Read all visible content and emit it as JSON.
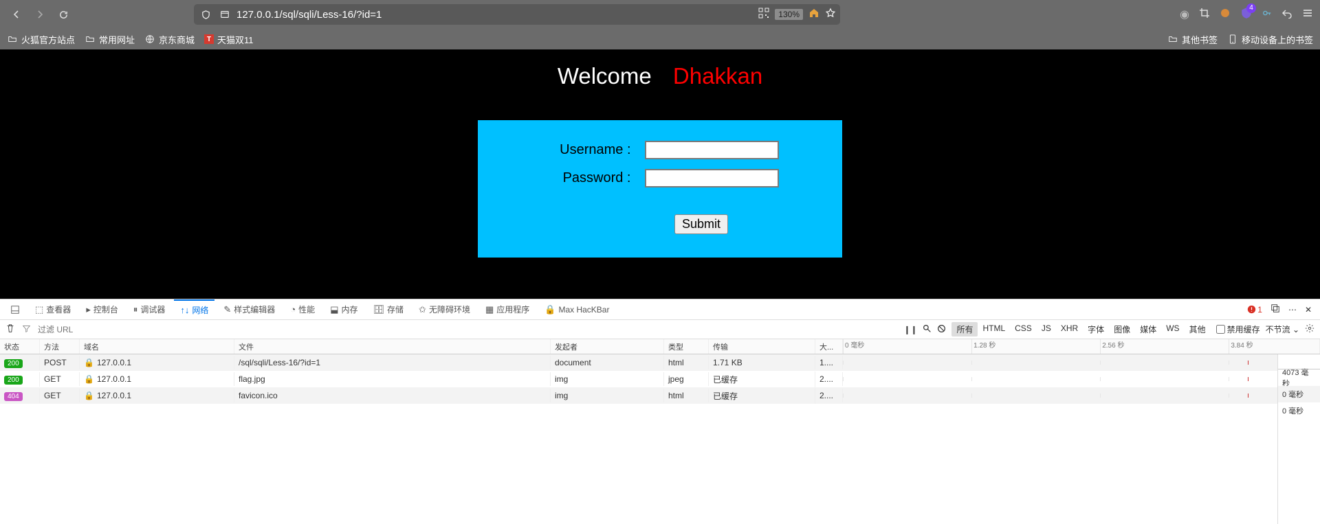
{
  "browser": {
    "url": "127.0.0.1/sql/sqli/Less-16/?id=1",
    "zoom": "130%",
    "extBadge": "4",
    "bookmarks": {
      "b1": "火狐官方站点",
      "b2": "常用网址",
      "b3": "京东商城",
      "b4": "天猫双11",
      "r1": "其他书签",
      "r2": "移动设备上的书签"
    }
  },
  "page": {
    "welcome1": "Welcome",
    "welcome2": "Dhakkan",
    "usernameLabel": "Username :",
    "passwordLabel": "Password :",
    "submit": "Submit"
  },
  "devtools": {
    "tabs": {
      "inspector": "查看器",
      "console": "控制台",
      "debugger": "调试器",
      "network": "网络",
      "style": "样式编辑器",
      "perf": "性能",
      "memory": "内存",
      "storage": "存储",
      "a11y": "无障碍环境",
      "app": "应用程序",
      "hackbar": "Max HacKBar"
    },
    "errors": "1",
    "filterPlaceholder": "过滤 URL",
    "typeFilters": {
      "all": "所有",
      "html": "HTML",
      "css": "CSS",
      "js": "JS",
      "xhr": "XHR",
      "font": "字体",
      "img": "图像",
      "media": "媒体",
      "ws": "WS",
      "other": "其他"
    },
    "disableCache": "禁用缓存",
    "noThrottle": "不节流",
    "headers": {
      "status": "状态",
      "method": "方法",
      "domain": "域名",
      "file": "文件",
      "initiator": "发起者",
      "type": "类型",
      "transfer": "传输",
      "size": "大..."
    },
    "wfTicks": {
      "t0": "0 毫秒",
      "t1": "1.28 秒",
      "t2": "2.56 秒",
      "t3": "3.84 秒"
    },
    "rows": [
      {
        "status": "200",
        "method": "POST",
        "domain": "127.0.0.1",
        "file": "/sql/sqli/Less-16/?id=1",
        "initiator": "document",
        "type": "html",
        "transfer": "1.71 KB",
        "size": "1....",
        "sum": "4073 毫秒"
      },
      {
        "status": "200",
        "method": "GET",
        "domain": "127.0.0.1",
        "file": "flag.jpg",
        "initiator": "img",
        "type": "jpeg",
        "transfer": "已缓存",
        "size": "2....",
        "sum": "0 毫秒"
      },
      {
        "status": "404",
        "method": "GET",
        "domain": "127.0.0.1",
        "file": "favicon.ico",
        "initiator": "img",
        "type": "html",
        "transfer": "已缓存",
        "size": "2....",
        "sum": "0 毫秒"
      }
    ]
  }
}
